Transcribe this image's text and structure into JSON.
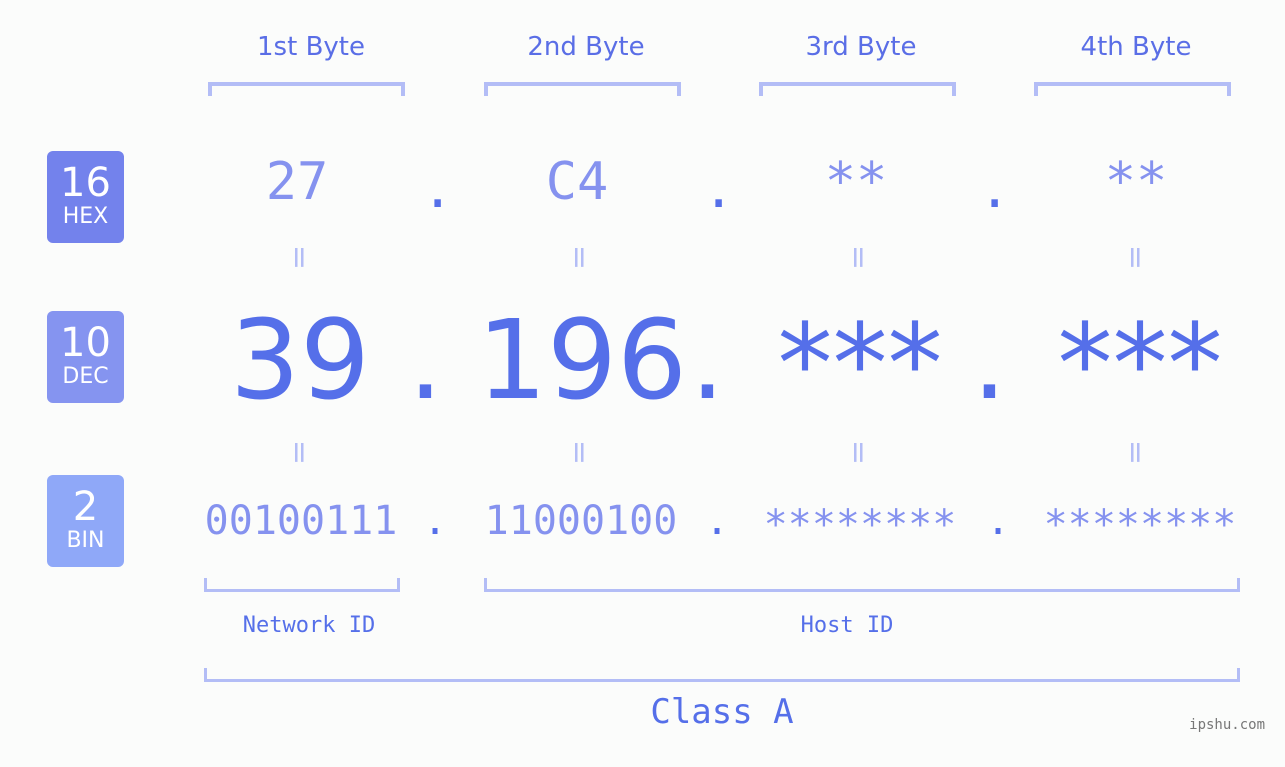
{
  "bases": [
    {
      "number": "16",
      "label": "HEX",
      "color": "#7382ec"
    },
    {
      "number": "10",
      "label": "DEC",
      "color": "#8594f0"
    },
    {
      "number": "2",
      "label": "BIN",
      "color": "#8fa8f8"
    }
  ],
  "byte_headers": [
    "1st Byte",
    "2nd Byte",
    "3rd Byte",
    "4th Byte"
  ],
  "hex": [
    "27",
    "C4",
    "**",
    "**"
  ],
  "dec": [
    "39",
    "196",
    "***",
    "***"
  ],
  "bin": [
    "00100111",
    "11000100",
    "********",
    "********"
  ],
  "separator": ".",
  "equals": "=",
  "network_label": "Network ID",
  "host_label": "Host ID",
  "class_label": "Class A",
  "watermark": "ipshu.com",
  "colors": {
    "accent": "#556fe9",
    "light": "#8592ef",
    "bracket": "#b3bdf6"
  }
}
